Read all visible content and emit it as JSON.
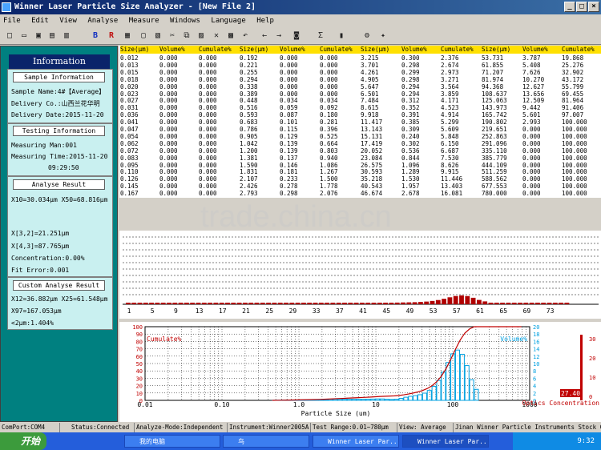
{
  "window": {
    "title": "Winner Laser Particle Size Analyzer - [New File 2]"
  },
  "menu": [
    "File",
    "Edit",
    "View",
    "Analyse",
    "Measure",
    "Windows",
    "Language",
    "Help"
  ],
  "toolbar": {
    "icons": [
      "new-file-icon",
      "open-folder-icon",
      "save-icon",
      "print-icon",
      "preview-icon",
      "bold-b-icon",
      "report-r-icon",
      "copy-window-icon",
      "monitor-icon",
      "device-icon",
      "cut-icon",
      "copy-icon",
      "paste-icon",
      "delete-icon",
      "properties-icon",
      "undo-icon",
      "arrow-left-icon",
      "arrow-right-icon",
      "camera-icon",
      "sigma-icon",
      "chart-icon",
      "tools-icon",
      "about-icon"
    ]
  },
  "info": {
    "title": "Information",
    "sample_head": "Sample Information",
    "sample_name": "Sample Name:4#【Average】",
    "delivery_co": "Delivery Co.:山西兰花华明",
    "delivery_date": "Delivery Date:2015-11-20",
    "testing_head": "Testing Information",
    "measuring_man": "Measuring Man:001",
    "measuring_time": "Measuring Time:2015-11-20",
    "measuring_clock": "09:29:50",
    "analyse_head": "Analyse Result",
    "x10_x50": "X10=30.034μm  X50=68.816μm",
    "x32": "X[3,2]=21.251μm",
    "x43": "X[4,3]=87.765μm",
    "concentration": "Concentration:0.00%",
    "fit_error": "Fit Error:0.001",
    "custom_head": "Custom Analyse Result",
    "x12_x25": "X12=36.882μm X25=61.548μm",
    "x97": "X97=167.053μm",
    "lt2": "<2μm:1.404%"
  },
  "table": {
    "headers": [
      "Size(μm)",
      "Volume%",
      "Cumulate%",
      "Size(μm)",
      "Volume%",
      "Cumulate%",
      "Size(μm)",
      "Volume%",
      "Cumulate%",
      "Size(μm)",
      "Volume%",
      "Cumulate%"
    ],
    "rows": [
      [
        "0.012",
        "0.000",
        "0.000",
        "0.192",
        "0.000",
        "0.000",
        "3.215",
        "0.300",
        "2.376",
        "53.731",
        "3.787",
        "19.868"
      ],
      [
        "0.013",
        "0.000",
        "0.000",
        "0.221",
        "0.000",
        "0.000",
        "3.701",
        "0.298",
        "2.674",
        "61.855",
        "5.408",
        "25.276"
      ],
      [
        "0.015",
        "0.000",
        "0.000",
        "0.255",
        "0.000",
        "0.000",
        "4.261",
        "0.299",
        "2.973",
        "71.207",
        "7.626",
        "32.902"
      ],
      [
        "0.018",
        "0.000",
        "0.000",
        "0.294",
        "0.000",
        "0.000",
        "4.905",
        "0.298",
        "3.271",
        "81.974",
        "10.270",
        "43.172"
      ],
      [
        "0.020",
        "0.000",
        "0.000",
        "0.338",
        "0.000",
        "0.000",
        "5.647",
        "0.294",
        "3.564",
        "94.368",
        "12.627",
        "55.799"
      ],
      [
        "0.023",
        "0.000",
        "0.000",
        "0.389",
        "0.000",
        "0.000",
        "6.501",
        "0.294",
        "3.859",
        "108.637",
        "13.656",
        "69.455"
      ],
      [
        "0.027",
        "0.000",
        "0.000",
        "0.448",
        "0.034",
        "0.034",
        "7.484",
        "0.312",
        "4.171",
        "125.063",
        "12.509",
        "81.964"
      ],
      [
        "0.031",
        "0.000",
        "0.000",
        "0.516",
        "0.059",
        "0.092",
        "8.615",
        "0.352",
        "4.523",
        "143.973",
        "9.442",
        "91.406"
      ],
      [
        "0.036",
        "0.000",
        "0.000",
        "0.593",
        "0.087",
        "0.180",
        "9.918",
        "0.391",
        "4.914",
        "165.742",
        "5.601",
        "97.007"
      ],
      [
        "0.041",
        "0.000",
        "0.000",
        "0.683",
        "0.101",
        "0.281",
        "11.417",
        "0.385",
        "5.299",
        "190.802",
        "2.993",
        "100.000"
      ],
      [
        "0.047",
        "0.000",
        "0.000",
        "0.786",
        "0.115",
        "0.396",
        "13.143",
        "0.309",
        "5.609",
        "219.651",
        "0.000",
        "100.000"
      ],
      [
        "0.054",
        "0.000",
        "0.000",
        "0.905",
        "0.129",
        "0.525",
        "15.131",
        "0.240",
        "5.848",
        "252.863",
        "0.000",
        "100.000"
      ],
      [
        "0.062",
        "0.000",
        "0.000",
        "1.042",
        "0.139",
        "0.664",
        "17.419",
        "0.302",
        "6.150",
        "291.096",
        "0.000",
        "100.000"
      ],
      [
        "0.072",
        "0.000",
        "0.000",
        "1.200",
        "0.139",
        "0.803",
        "20.052",
        "0.536",
        "6.687",
        "335.110",
        "0.000",
        "100.000"
      ],
      [
        "0.083",
        "0.000",
        "0.000",
        "1.381",
        "0.137",
        "0.940",
        "23.084",
        "0.844",
        "7.530",
        "385.779",
        "0.000",
        "100.000"
      ],
      [
        "0.095",
        "0.000",
        "0.000",
        "1.590",
        "0.146",
        "1.086",
        "26.575",
        "1.096",
        "8.626",
        "444.109",
        "0.000",
        "100.000"
      ],
      [
        "0.110",
        "0.000",
        "0.000",
        "1.831",
        "0.181",
        "1.267",
        "30.593",
        "1.289",
        "9.915",
        "511.259",
        "0.000",
        "100.000"
      ],
      [
        "0.126",
        "0.000",
        "0.000",
        "2.107",
        "0.233",
        "1.500",
        "35.218",
        "1.530",
        "11.446",
        "588.562",
        "0.000",
        "100.000"
      ],
      [
        "0.145",
        "0.000",
        "0.000",
        "2.426",
        "0.278",
        "1.778",
        "40.543",
        "1.957",
        "13.403",
        "677.553",
        "0.000",
        "100.000"
      ],
      [
        "0.167",
        "0.000",
        "0.000",
        "2.793",
        "0.298",
        "2.076",
        "46.674",
        "2.678",
        "16.081",
        "780.000",
        "0.000",
        "100.000"
      ]
    ]
  },
  "bar_labels": [
    "1",
    "5",
    "9",
    "13",
    "17",
    "21",
    "25",
    "29",
    "33",
    "37",
    "41",
    "45",
    "49",
    "53",
    "57",
    "61",
    "65",
    "69",
    "73"
  ],
  "chart_data": {
    "type": "bar",
    "title": "",
    "x_ticks": [
      "0.01",
      "0.10",
      "1.0",
      "10",
      "100",
      "1000"
    ],
    "xlabel": "Particle Size (um)",
    "left_label": "Cumulate%",
    "left_ticks": [
      "0",
      "10",
      "20",
      "30",
      "40",
      "50",
      "60",
      "70",
      "80",
      "90",
      "100"
    ],
    "right_label": "Volume%",
    "right_ticks": [
      "0",
      "2",
      "4",
      "6",
      "8",
      "10",
      "12",
      "14",
      "16",
      "18",
      "20"
    ],
    "x": [
      0.448,
      0.516,
      0.593,
      0.683,
      0.786,
      0.905,
      1.042,
      1.2,
      1.381,
      1.59,
      1.831,
      2.107,
      2.426,
      2.793,
      3.215,
      3.701,
      4.261,
      4.905,
      5.647,
      6.501,
      7.484,
      8.615,
      9.918,
      11.417,
      13.143,
      15.131,
      17.419,
      20.052,
      23.084,
      26.575,
      30.593,
      35.218,
      40.543,
      46.674,
      53.731,
      61.855,
      71.207,
      81.974,
      94.368,
      108.637,
      125.063,
      143.973,
      165.742,
      190.802
    ],
    "volume": [
      0.034,
      0.059,
      0.087,
      0.101,
      0.115,
      0.129,
      0.139,
      0.139,
      0.137,
      0.146,
      0.181,
      0.233,
      0.278,
      0.298,
      0.3,
      0.298,
      0.299,
      0.298,
      0.294,
      0.294,
      0.312,
      0.352,
      0.391,
      0.385,
      0.309,
      0.24,
      0.302,
      0.536,
      0.844,
      1.096,
      1.289,
      1.53,
      1.957,
      2.678,
      3.787,
      5.408,
      7.626,
      10.27,
      12.627,
      13.656,
      12.509,
      9.442,
      5.601,
      2.993
    ],
    "cumulate": [
      0.034,
      0.092,
      0.18,
      0.281,
      0.396,
      0.525,
      0.664,
      0.803,
      0.94,
      1.086,
      1.267,
      1.5,
      1.778,
      2.076,
      2.376,
      2.674,
      2.973,
      3.271,
      3.564,
      3.859,
      4.171,
      4.523,
      4.914,
      5.299,
      5.609,
      5.848,
      6.15,
      6.687,
      7.53,
      8.626,
      9.915,
      11.446,
      13.403,
      16.081,
      19.868,
      25.276,
      32.902,
      43.172,
      55.799,
      69.455,
      81.964,
      91.406,
      97.007,
      100.0
    ],
    "concentration_label": "Optics Concentration",
    "concentration_value": "27.40",
    "conc_ticks": [
      "0",
      "10",
      "20",
      "30"
    ]
  },
  "status": {
    "comport": "ComPort:COM4",
    "status": "Status:Connected",
    "mode": "Analyze-Mode:Independent",
    "instrument": "Instrument:Winner2005A",
    "range": "Test Range:0.01~780μm",
    "view": "View: Average",
    "company": "Jinan Winner Particle Instruments Stock C"
  },
  "taskbar": {
    "start": "开始",
    "tasks": [
      "我的电脑",
      "鸟",
      "Winner Laser Par...",
      "Winner Laser Par..."
    ],
    "clock": "9:32"
  },
  "watermark": "trade.china.cn",
  "colors": {
    "accent": "#0a246a",
    "panel": "#008080",
    "header": "#ffe000",
    "cumulate": "#c00000",
    "volume": "#00a0e0"
  }
}
